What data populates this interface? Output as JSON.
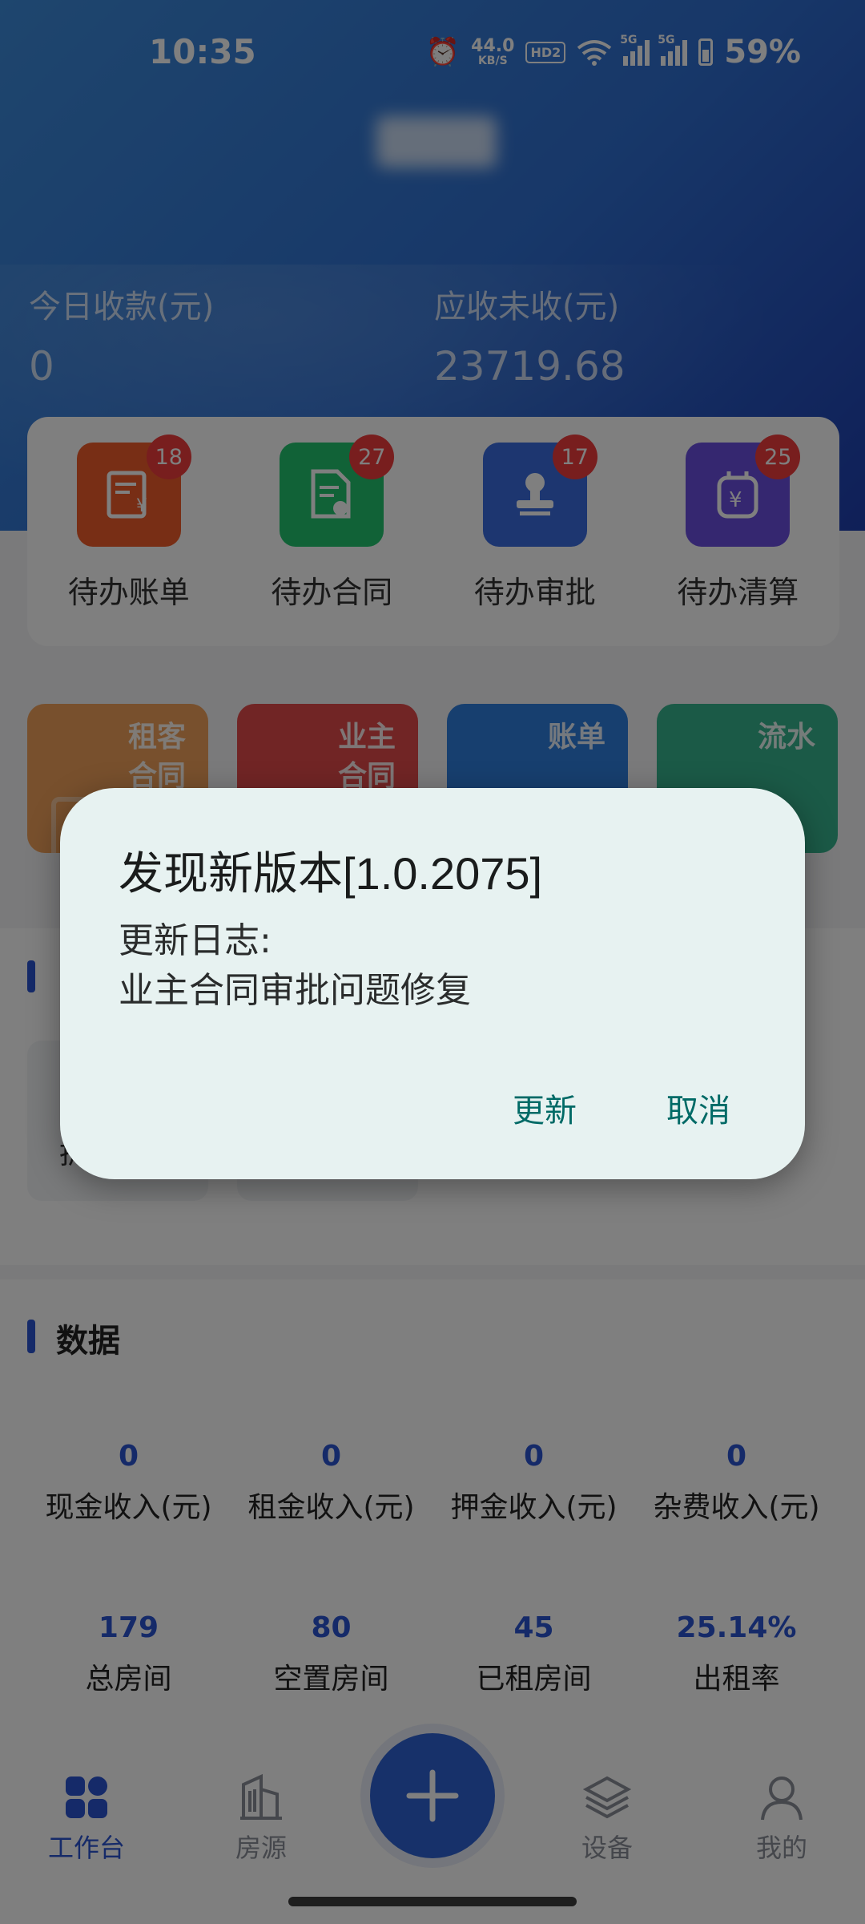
{
  "status_bar": {
    "time": "10:35",
    "net_speed_value": "44.0",
    "net_speed_unit": "KB/S",
    "hd_label": "HD2",
    "signal_1_tag": "5G",
    "signal_2_tag": "5G",
    "battery": "59%"
  },
  "summary": {
    "today_received_label": "今日收款(元)",
    "today_received_value": "0",
    "receivable_label": "应收未收(元)",
    "receivable_value": "23719.68"
  },
  "todo": {
    "items": [
      {
        "label": "待办账单",
        "badge": "18",
        "color": "#f15d2a",
        "icon": "bill-icon"
      },
      {
        "label": "待办合同",
        "badge": "27",
        "color": "#22c46f",
        "icon": "contract-icon"
      },
      {
        "label": "待办审批",
        "badge": "17",
        "color": "#3a6de0",
        "icon": "approval-stamp-icon"
      },
      {
        "label": "待办清算",
        "badge": "25",
        "color": "#6a4fe0",
        "icon": "settlement-icon"
      }
    ]
  },
  "quick_actions": [
    {
      "line1": "租客",
      "line2": "合同",
      "color": "#f0a05a"
    },
    {
      "line1": "业主",
      "line2": "合同",
      "color": "#e24b4b"
    },
    {
      "line1": "账单",
      "line2": "",
      "color": "#2f7fde"
    },
    {
      "line1": "流水",
      "line2": "",
      "color": "#36b58e"
    }
  ],
  "section_two": {
    "partial_text": "拆"
  },
  "data_section": {
    "title": "数据",
    "row1": [
      {
        "value": "0",
        "label": "现金收入(元)"
      },
      {
        "value": "0",
        "label": "租金收入(元)"
      },
      {
        "value": "0",
        "label": "押金收入(元)"
      },
      {
        "value": "0",
        "label": "杂费收入(元)"
      }
    ],
    "row2": [
      {
        "value": "179",
        "label": "总房间"
      },
      {
        "value": "80",
        "label": "空置房间"
      },
      {
        "value": "45",
        "label": "已租房间"
      },
      {
        "value": "25.14%",
        "label": "出租率"
      }
    ]
  },
  "tabbar": {
    "workbench": "工作台",
    "properties": "房源",
    "devices": "设备",
    "mine": "我的"
  },
  "dialog": {
    "title": "发现新版本[1.0.2075]",
    "log_label": "更新日志:",
    "log_content": "业主合同审批问题修复",
    "update_button": "更新",
    "cancel_button": "取消"
  },
  "colors": {
    "accent": "#2b54d3",
    "dialog_button": "#006a66",
    "badge": "#f03c3c"
  }
}
